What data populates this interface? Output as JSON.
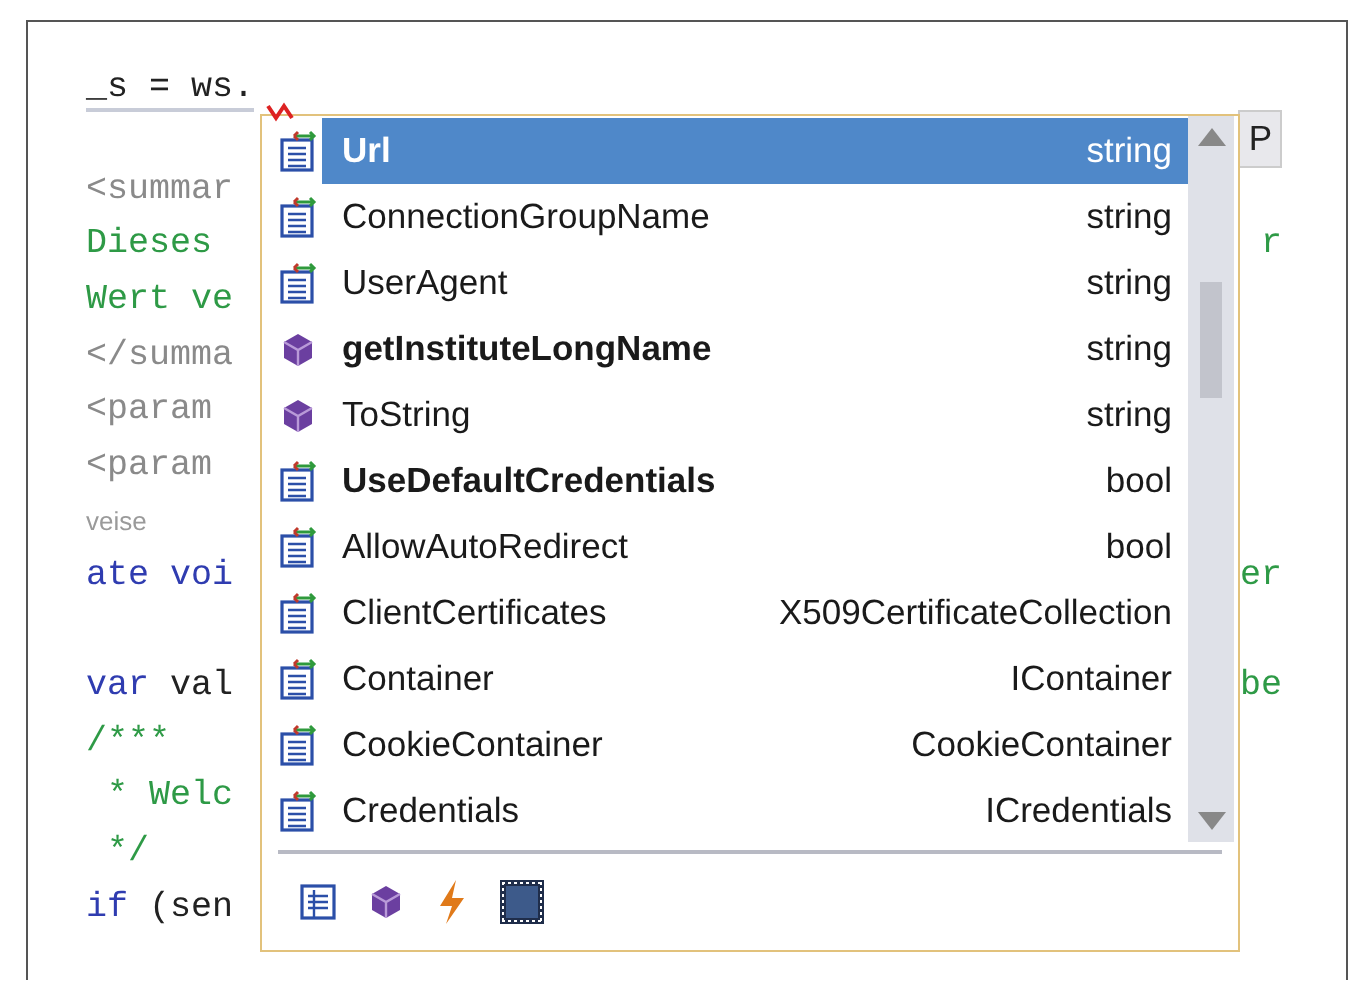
{
  "code_lines": [
    {
      "segments": [
        {
          "text": "_s = ws.",
          "kind": "plain"
        }
      ],
      "error": true
    },
    {
      "right": "P",
      "tab": true
    },
    {
      "segments": [
        {
          "text": "<summar",
          "kind": "doc"
        }
      ]
    },
    {
      "segments": [
        {
          "text": "Dieses",
          "kind": "comment"
        }
      ],
      "right": "r"
    },
    {
      "segments": [
        {
          "text": "Wert ve",
          "kind": "comment"
        }
      ]
    },
    {
      "segments": [
        {
          "text": "</summa",
          "kind": "doc"
        }
      ]
    },
    {
      "segments": [
        {
          "text": "<param",
          "kind": "doc"
        }
      ]
    },
    {
      "segments": [
        {
          "text": "<param",
          "kind": "doc"
        }
      ]
    },
    {
      "segments": [
        {
          "text": "veise",
          "kind": "hint"
        }
      ]
    },
    {
      "segments": [
        {
          "text": "ate voi",
          "kind": "keyword"
        }
      ],
      "right": "er"
    },
    {
      "blank_before": true,
      "segments": [
        {
          "text": "var",
          "kind": "keyword"
        },
        {
          "text": " val",
          "kind": "plain"
        }
      ],
      "right": "be"
    },
    {
      "segments": [
        {
          "text": "/***",
          "kind": "comment"
        }
      ]
    },
    {
      "segments": [
        {
          "text": " * Welc",
          "kind": "comment"
        }
      ]
    },
    {
      "segments": [
        {
          "text": " */",
          "kind": "comment"
        }
      ]
    },
    {
      "segments": [
        {
          "text": "if",
          "kind": "keyword"
        },
        {
          "text": " (sen",
          "kind": "plain"
        }
      ]
    }
  ],
  "completion": {
    "items": [
      {
        "kind": "property",
        "name": "Url",
        "type": "string",
        "bold": true,
        "selected": true
      },
      {
        "kind": "property",
        "name": "ConnectionGroupName",
        "type": "string",
        "bold": false,
        "selected": false
      },
      {
        "kind": "property",
        "name": "UserAgent",
        "type": "string",
        "bold": false,
        "selected": false
      },
      {
        "kind": "method",
        "name": "getInstituteLongName",
        "type": "string",
        "bold": true,
        "selected": false
      },
      {
        "kind": "method",
        "name": "ToString",
        "type": "string",
        "bold": false,
        "selected": false
      },
      {
        "kind": "property",
        "name": "UseDefaultCredentials",
        "type": "bool",
        "bold": true,
        "selected": false
      },
      {
        "kind": "property",
        "name": "AllowAutoRedirect",
        "type": "bool",
        "bold": false,
        "selected": false
      },
      {
        "kind": "property",
        "name": "ClientCertificates",
        "type": "X509CertificateCollection",
        "bold": false,
        "selected": false
      },
      {
        "kind": "property",
        "name": "Container",
        "type": "IContainer",
        "bold": false,
        "selected": false
      },
      {
        "kind": "property",
        "name": "CookieContainer",
        "type": "CookieContainer",
        "bold": false,
        "selected": false
      },
      {
        "kind": "property",
        "name": "Credentials",
        "type": "ICredentials",
        "bold": false,
        "selected": false
      }
    ],
    "filters": [
      {
        "kind": "property"
      },
      {
        "kind": "method"
      },
      {
        "kind": "event"
      },
      {
        "kind": "field"
      }
    ]
  }
}
